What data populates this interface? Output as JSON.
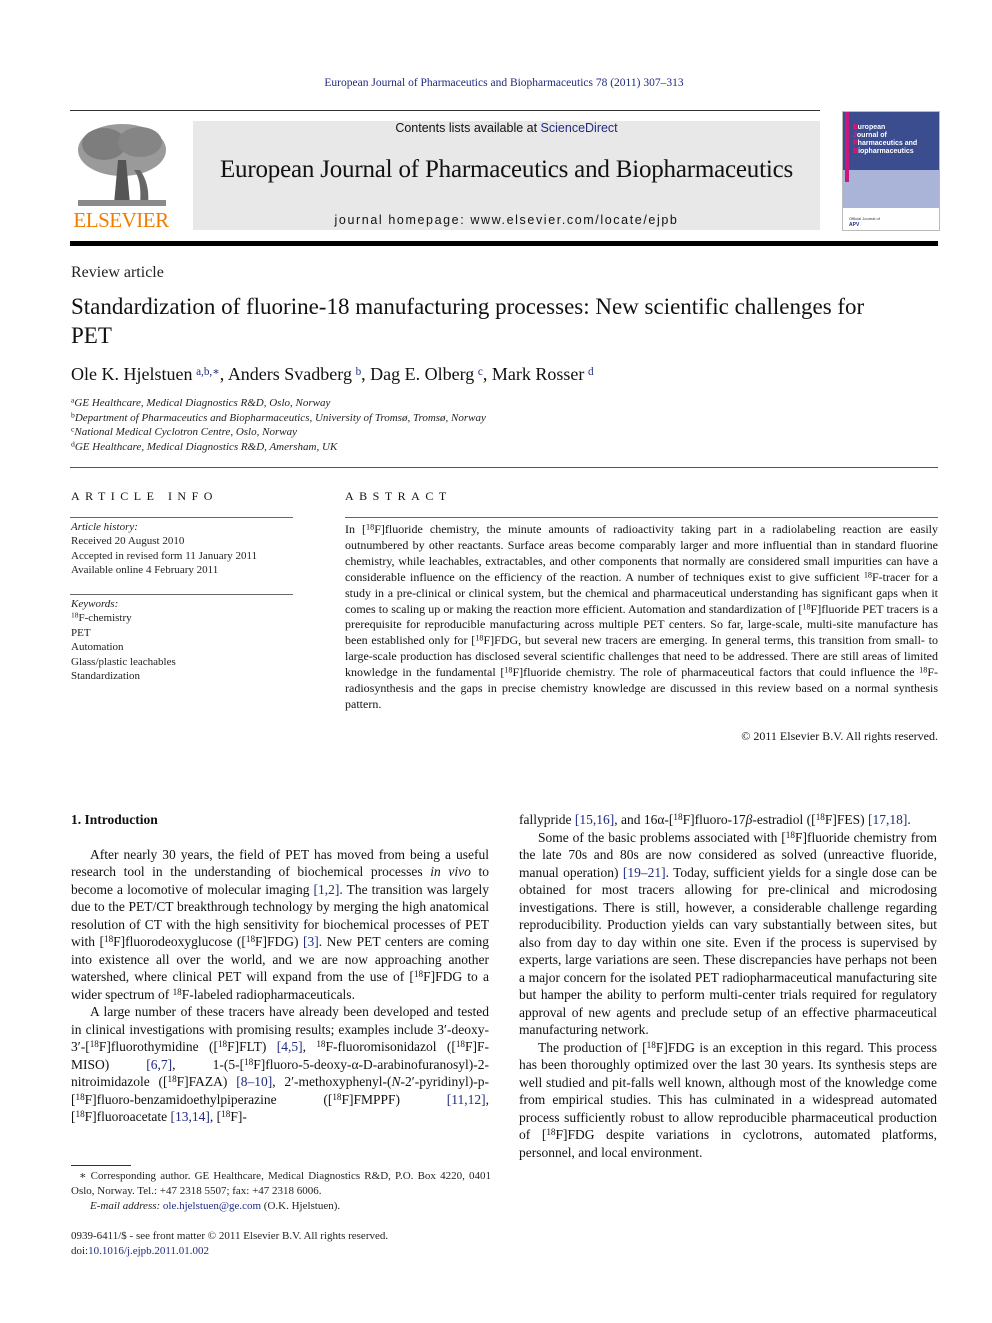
{
  "header": {
    "journal_reference": "European Journal of Pharmaceutics and Biopharmaceutics 78 (2011) 307–313",
    "contents_prefix": "Contents lists available at ",
    "contents_link": "ScienceDirect",
    "journal_title": "European Journal of Pharmaceutics and Biopharmaceutics",
    "homepage": "journal homepage: www.elsevier.com/locate/ejpb",
    "publisher_logo_text": "ELSEVIER",
    "cover": {
      "title_lines": [
        "European",
        "Journal of",
        "Pharmaceutics and",
        "Biopharmaceutics"
      ],
      "official_text": "Official Journal of",
      "society": "APV"
    }
  },
  "article": {
    "type": "Review article",
    "title": "Standardization of fluorine-18 manufacturing processes: New scientific challenges for PET",
    "authors": [
      {
        "name": "Ole K. Hjelstuen",
        "affil": "a,b,∗"
      },
      {
        "name": "Anders Svadberg",
        "affil": "b"
      },
      {
        "name": "Dag E. Olberg",
        "affil": "c"
      },
      {
        "name": "Mark Rosser",
        "affil": "d"
      }
    ],
    "affiliations": [
      {
        "key": "a",
        "text": "GE Healthcare, Medical Diagnostics R&D, Oslo, Norway"
      },
      {
        "key": "b",
        "text": "Department of Pharmaceutics and Biopharmaceutics, University of Tromsø, Tromsø, Norway"
      },
      {
        "key": "c",
        "text": "National Medical Cyclotron Centre, Oslo, Norway"
      },
      {
        "key": "d",
        "text": "GE Healthcare, Medical Diagnostics R&D, Amersham, UK"
      }
    ]
  },
  "article_info": {
    "heading": "ARTICLE INFO",
    "history_label": "Article history:",
    "history": [
      "Received 20 August 2010",
      "Accepted in revised form 11 January 2011",
      "Available online 4 February 2011"
    ],
    "keywords_label": "Keywords:",
    "keywords": [
      "18F-chemistry",
      "PET",
      "Automation",
      "Glass/plastic leachables",
      "Standardization"
    ]
  },
  "abstract": {
    "heading": "ABSTRACT",
    "text": "In [18F]fluoride chemistry, the minute amounts of radioactivity taking part in a radiolabeling reaction are easily outnumbered by other reactants. Surface areas become comparably larger and more influential than in standard fluorine chemistry, while leachables, extractables, and other components that normally are considered small impurities can have a considerable influence on the efficiency of the reaction. A number of techniques exist to give sufficient 18F-tracer for a study in a pre-clinical or clinical system, but the chemical and pharmaceutical understanding has significant gaps when it comes to scaling up or making the reaction more efficient. Automation and standardization of [18F]fluoride PET tracers is a prerequisite for reproducible manufacturing across multiple PET centers. So far, large-scale, multi-site manufacture has been established only for [18F]FDG, but several new tracers are emerging. In general terms, this transition from small- to large-scale production has disclosed several scientific challenges that need to be addressed. There are still areas of limited knowledge in the fundamental [18F]fluoride chemistry. The role of pharmaceutical factors that could influence the 18F-radiosynthesis and the gaps in precise chemistry knowledge are discussed in this review based on a normal synthesis pattern.",
    "copyright": "© 2011 Elsevier B.V. All rights reserved."
  },
  "body": {
    "section_heading": "1. Introduction",
    "left_paragraphs": [
      "After nearly 30 years, the field of PET has moved from being a useful research tool in the understanding of biochemical processes in vivo to become a locomotive of molecular imaging [1,2]. The transition was largely due to the PET/CT breakthrough technology by merging the high anatomical resolution of CT with the high sensitivity for biochemical processes of PET with [18F]fluorodeoxyglucose ([18F]FDG) [3]. New PET centers are coming into existence all over the world, and we are now approaching another watershed, where clinical PET will expand from the use of [18F]FDG to a wider spectrum of 18F-labeled radiopharmaceuticals.",
      "A large number of these tracers have already been developed and tested in clinical investigations with promising results; examples include 3′-deoxy-3′-[18F]fluorothymidine ([18F]FLT) [4,5], 18F-fluoromisonidazol ([18F]F-MISO) [6,7], 1-(5-[18F]fluoro-5-deoxy-α-D-arabinofuranosyl)-2-nitroimidazole ([18F]FAZA) [8–10], 2′-methoxyphenyl-(N-2′-pyridinyl)-p-[18F]fluoro-benzamidoethylpiperazine ([18F]FMPPF) [11,12], [18F]fluoroacetate [13,14], [18F]-"
    ],
    "right_paragraphs": [
      "fallypride [15,16], and 16α-[18F]fluoro-17β-estradiol ([18F]FES) [17,18].",
      "Some of the basic problems associated with [18F]fluoride chemistry from the late 70s and 80s are now considered as solved (unreactive fluoride, manual operation) [19–21]. Today, sufficient yields for a single dose can be obtained for most tracers allowing for pre-clinical and microdosing investigations. There is still, however, a considerable challenge regarding reproducibility. Production yields can vary substantially between sites, but also from day to day within one site. Even if the process is supervised by experts, large variations are seen. These discrepancies have perhaps not been a major concern for the isolated PET radiopharmaceutical manufacturing site but hamper the ability to perform multi-center trials required for regulatory approval of new agents and preclude setup of an effective pharmaceutical manufacturing network.",
      "The production of [18F]FDG is an exception in this regard. This process has been thoroughly optimized over the last 30 years. Its synthesis steps are well studied and pit-falls well known, although most of the knowledge come from empirical studies. This has culminated in a widespread automated process sufficiently robust to allow reproducible pharmaceutical production of [18F]FDG despite variations in cyclotrons, automated platforms, personnel, and local environment."
    ]
  },
  "footnote": {
    "corresponding": "∗ Corresponding author. GE Healthcare, Medical Diagnostics R&D, P.O. Box 4220, 0401 Oslo, Norway. Tel.: +47 2318 5507; fax: +47 2318 6006.",
    "email_label": "E-mail address:",
    "email": "ole.hjelstuen@ge.com",
    "email_suffix": "(O.K. Hjelstuen).",
    "issn": "0939-6411/$ - see front matter © 2011 Elsevier B.V. All rights reserved.",
    "doi_prefix": "doi:",
    "doi": "10.1016/j.ejpb.2011.01.002"
  },
  "colors": {
    "link": "#1f2a80",
    "elsevier_orange": "#f07c00",
    "header_box": "#e8e8e8",
    "cover_blue": "#3b4c8f",
    "cover_magenta": "#c8187a"
  }
}
